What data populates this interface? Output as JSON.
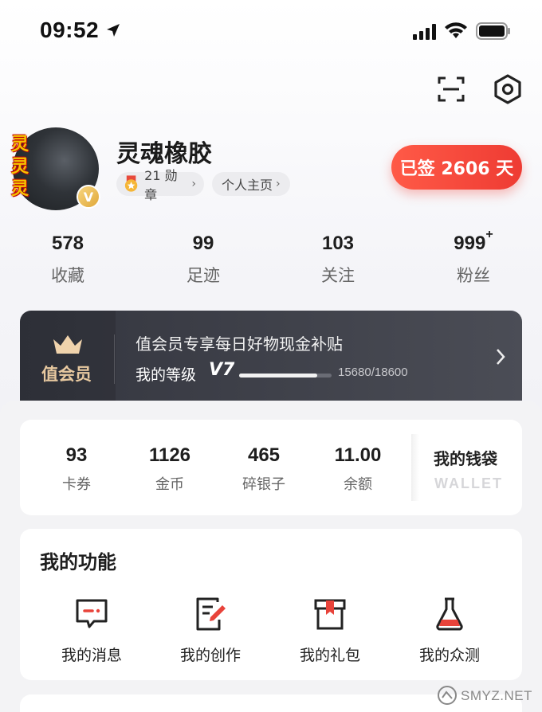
{
  "status_bar": {
    "time": "09:52"
  },
  "profile": {
    "avatar_text": "灵灵灵",
    "vip_mark": "V",
    "username": "灵魂橡胶",
    "medal_count_label": "21 勋章",
    "homepage_label": "个人主页",
    "checkin_label": "已签 2606 天"
  },
  "stats": [
    {
      "value": "578",
      "label": "收藏"
    },
    {
      "value": "99",
      "label": "足迹"
    },
    {
      "value": "103",
      "label": "关注"
    },
    {
      "value": "999",
      "suffix": "+",
      "label": "粉丝"
    }
  ],
  "vip": {
    "title": "值会员",
    "description": "值会员专享每日好物现金补贴",
    "level_label": "我的等级",
    "level_value": "V7",
    "points": "15680/18600",
    "progress_fraction": 0.843
  },
  "wallet": {
    "items": [
      {
        "value": "93",
        "label": "卡券"
      },
      {
        "value": "1126",
        "label": "金币"
      },
      {
        "value": "465",
        "label": "碎银子"
      },
      {
        "value": "11.00",
        "label": "余额"
      }
    ],
    "title": "我的钱袋",
    "subtitle": "WALLET"
  },
  "functions": {
    "title": "我的功能",
    "items": [
      {
        "label": "我的消息",
        "icon": "message-icon"
      },
      {
        "label": "我的创作",
        "icon": "edit-icon"
      },
      {
        "label": "我的礼包",
        "icon": "gift-icon"
      },
      {
        "label": "我的众测",
        "icon": "flask-icon"
      }
    ]
  },
  "watermark": "SMYZ.NET",
  "colors": {
    "accent": "#ee3b33",
    "vip_gold": "#e8c9a0",
    "vip_bg": "#3a3c45"
  }
}
